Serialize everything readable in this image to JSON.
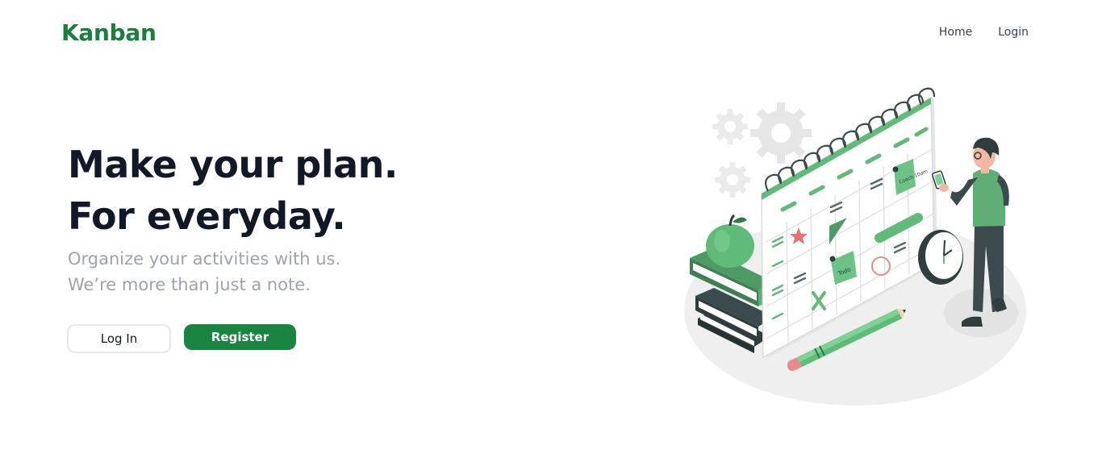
{
  "header": {
    "logo": "Kanban",
    "nav": [
      {
        "label": "Home"
      },
      {
        "label": "Login"
      }
    ]
  },
  "hero": {
    "title_line1": "Make your plan.",
    "title_line2": "For everyday.",
    "subtitle_line1": "Organize your activities with us.",
    "subtitle_line2": "We’re more than just a note.",
    "login_label": "Log In",
    "register_label": "Register"
  },
  "colors": {
    "brand_green": "#1a7f3c",
    "button_green": "#1a8540",
    "title_dark": "#111827",
    "subtitle_gray": "#9ca3af"
  },
  "illustration": {
    "note_text_1": "Coach 10am",
    "note_text_2": "Todo"
  }
}
